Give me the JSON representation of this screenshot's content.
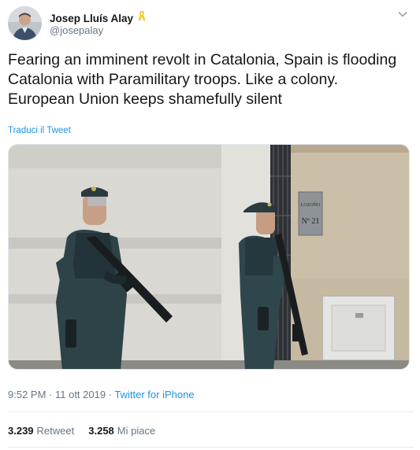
{
  "user": {
    "display_name": "Josep Lluís Alay",
    "handle": "@josepalay",
    "badge_icon": "yellow-ribbon-icon"
  },
  "tweet": {
    "text": "Fearing an imminent revolt in Catalonia, Spain is flooding Catalonia with Paramilitary troops. Like a colony. European Union keeps shamefully silent",
    "translate_label": "Traduci il Tweet"
  },
  "photo": {
    "sign_line1": "LOZOÑO",
    "sign_line2": "Nº 21"
  },
  "meta": {
    "time": "9:52 PM",
    "separator": " · ",
    "date": "11 ott 2019",
    "source": "Twitter for iPhone"
  },
  "stats": {
    "retweets_count": "3.239",
    "retweets_label": "Retweet",
    "likes_count": "3.258",
    "likes_label": "Mi piace"
  },
  "colors": {
    "link": "#1b95e0",
    "secondary_text": "#657786",
    "primary_text": "#14171a",
    "ribbon": "#f5c518"
  }
}
